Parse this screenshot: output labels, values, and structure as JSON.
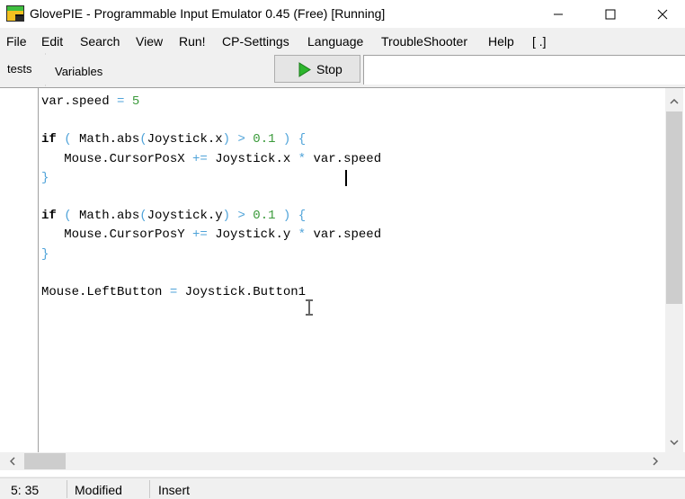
{
  "window": {
    "title": "GlovePIE - Programmable Input Emulator 0.45 (Free) [Running]"
  },
  "menu": [
    "File",
    "Edit",
    "Search",
    "View",
    "Run!",
    "CP-Settings",
    "Language",
    "TroubleShooter",
    "Help",
    "[ .]"
  ],
  "tabs": [
    "tests",
    "Variables"
  ],
  "toolbar": {
    "stop_label": "Stop"
  },
  "code_lines": [
    [
      {
        "t": "var.speed ",
        "c": ""
      },
      {
        "t": "=",
        "c": "op"
      },
      {
        "t": " ",
        "c": ""
      },
      {
        "t": "5",
        "c": "num"
      }
    ],
    [],
    [
      {
        "t": "if",
        "c": "kw"
      },
      {
        "t": " ",
        "c": ""
      },
      {
        "t": "(",
        "c": "op"
      },
      {
        "t": " Math.abs",
        "c": ""
      },
      {
        "t": "(",
        "c": "op"
      },
      {
        "t": "Joystick.x",
        "c": ""
      },
      {
        "t": ")",
        "c": "op"
      },
      {
        "t": " ",
        "c": ""
      },
      {
        "t": ">",
        "c": "op"
      },
      {
        "t": " ",
        "c": ""
      },
      {
        "t": "0.1",
        "c": "num"
      },
      {
        "t": " ",
        "c": ""
      },
      {
        "t": ")",
        "c": "op"
      },
      {
        "t": " ",
        "c": ""
      },
      {
        "t": "{",
        "c": "op"
      }
    ],
    [
      {
        "t": "   Mouse.CursorPosX ",
        "c": ""
      },
      {
        "t": "+=",
        "c": "op"
      },
      {
        "t": " Joystick.x ",
        "c": ""
      },
      {
        "t": "*",
        "c": "op"
      },
      {
        "t": " var.speed",
        "c": ""
      }
    ],
    [
      {
        "t": "}",
        "c": "op"
      }
    ],
    [],
    [
      {
        "t": "if",
        "c": "kw"
      },
      {
        "t": " ",
        "c": ""
      },
      {
        "t": "(",
        "c": "op"
      },
      {
        "t": " Math.abs",
        "c": ""
      },
      {
        "t": "(",
        "c": "op"
      },
      {
        "t": "Joystick.y",
        "c": ""
      },
      {
        "t": ")",
        "c": "op"
      },
      {
        "t": " ",
        "c": ""
      },
      {
        "t": ">",
        "c": "op"
      },
      {
        "t": " ",
        "c": ""
      },
      {
        "t": "0.1",
        "c": "num"
      },
      {
        "t": " ",
        "c": ""
      },
      {
        "t": ")",
        "c": "op"
      },
      {
        "t": " ",
        "c": ""
      },
      {
        "t": "{",
        "c": "op"
      }
    ],
    [
      {
        "t": "   Mouse.CursorPosY ",
        "c": ""
      },
      {
        "t": "+=",
        "c": "op"
      },
      {
        "t": " Joystick.y ",
        "c": ""
      },
      {
        "t": "*",
        "c": "op"
      },
      {
        "t": " var.speed",
        "c": ""
      }
    ],
    [
      {
        "t": "}",
        "c": "op"
      }
    ],
    [],
    [
      {
        "t": "Mouse.LeftButton ",
        "c": ""
      },
      {
        "t": "=",
        "c": "op"
      },
      {
        "t": " Joystick.Button1",
        "c": ""
      }
    ]
  ],
  "status": {
    "position": "5: 35",
    "modified": "Modified",
    "mode": "Insert"
  },
  "colors": {
    "operator": "#4fa3d9",
    "number": "#3a9a3a",
    "play": "#2db52d"
  },
  "icons": {
    "minimize": "minimize-icon",
    "maximize": "maximize-icon",
    "close": "close-icon",
    "run": "play-icon"
  }
}
